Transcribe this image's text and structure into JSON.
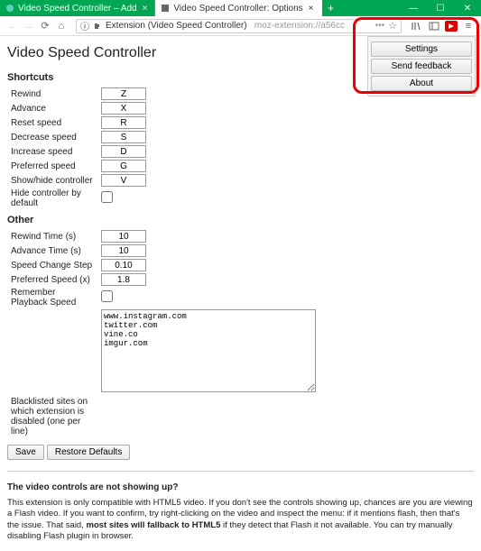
{
  "window": {
    "tab1_title": "Video Speed Controller – Add",
    "tab2_title": "Video Speed Controller: Options"
  },
  "urlbar": {
    "prefix": "Extension (Video Speed Controller)",
    "path": "moz-extension://a56cc"
  },
  "popup": {
    "settings": "Settings",
    "feedback": "Send feedback",
    "about": "About"
  },
  "page": {
    "title": "Video Speed Controller",
    "section_shortcuts": "Shortcuts",
    "section_other": "Other"
  },
  "shortcuts": {
    "rewind_label": "Rewind",
    "rewind_key": "Z",
    "advance_label": "Advance",
    "advance_key": "X",
    "reset_label": "Reset speed",
    "reset_key": "R",
    "decrease_label": "Decrease speed",
    "decrease_key": "S",
    "increase_label": "Increase speed",
    "increase_key": "D",
    "preferred_label": "Preferred speed",
    "preferred_key": "G",
    "showhide_label": "Show/hide controller",
    "showhide_key": "V",
    "hide_default_label": "Hide controller by default"
  },
  "other": {
    "rewind_time_label": "Rewind Time (s)",
    "rewind_time_val": "10",
    "advance_time_label": "Advance Time (s)",
    "advance_time_val": "10",
    "step_label": "Speed Change Step",
    "step_val": "0.10",
    "pref_speed_label": "Preferred Speed (x)",
    "pref_speed_val": "1.8",
    "remember_label": "Remember Playback Speed",
    "blacklist_val": "www.instagram.com\ntwitter.com\nvine.co\nimgur.com",
    "blacklist_label": "Blacklisted sites on which extension is disabled (one per line)"
  },
  "buttons": {
    "save": "Save",
    "restore": "Restore Defaults"
  },
  "help": {
    "title": "The video controls are not showing up?",
    "text1": "This extension is only compatible with HTML5 video. If you don't see the controls showing up, chances are you are viewing a Flash video. If you want to confirm, try right-clicking on the video and inspect the menu: if it mentions flash, then that's the issue. That said, ",
    "text_bold": "most sites will fallback to HTML5",
    "text2": " if they detect that Flash it not available. You can try manually disabling Flash plugin in browser."
  }
}
